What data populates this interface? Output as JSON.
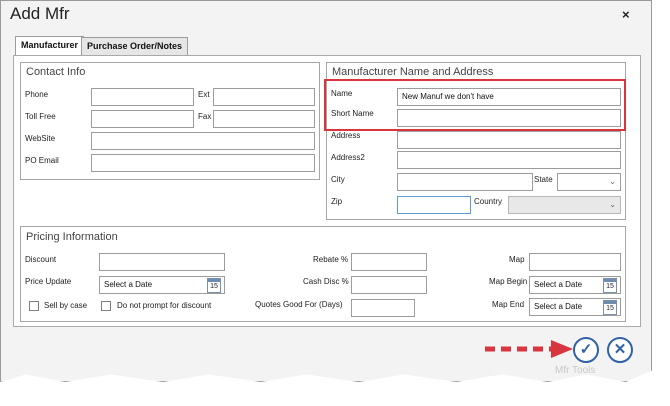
{
  "dialog": {
    "title": "Add Mfr",
    "close_label": "×"
  },
  "tabs": [
    {
      "label": "Manufacturer",
      "active": true
    },
    {
      "label": "Purchase Order/Notes",
      "active": false
    }
  ],
  "contact": {
    "title": "Contact Info",
    "phone_label": "Phone",
    "ext_label": "Ext",
    "toll_free_label": "Toll Free",
    "fax_label": "Fax",
    "website_label": "WebSite",
    "po_email_label": "PO Email"
  },
  "address": {
    "title": "Manufacturer Name and Address",
    "name_label": "Name",
    "name_value": "New Manuf we don't have",
    "short_name_label": "Short Name",
    "address_label": "Address",
    "address2_label": "Address2",
    "city_label": "City",
    "state_label": "State",
    "zip_label": "Zip",
    "country_label": "Country"
  },
  "pricing": {
    "title": "Pricing Information",
    "discount_label": "Discount",
    "price_update_label": "Price Update",
    "price_update_placeholder": "Select a Date",
    "sell_by_case_label": "Sell by case",
    "no_prompt_label": "Do not prompt for discount",
    "rebate_label": "Rebate %",
    "cash_disc_label": "Cash Disc %",
    "quotes_good_label": "Quotes Good For (Days)",
    "map_label": "Map",
    "map_begin_label": "Map Begin",
    "map_begin_placeholder": "Select a Date",
    "map_end_label": "Map End",
    "map_end_placeholder": "Select a Date",
    "calendar_day": "15"
  },
  "footer": {
    "ok_icon": "✓",
    "cancel_icon": "✕",
    "ghost_text": "Mfr Tools"
  },
  "annotation": {
    "highlight_color": "#d9353f",
    "arrow_color": "#d9353f"
  }
}
